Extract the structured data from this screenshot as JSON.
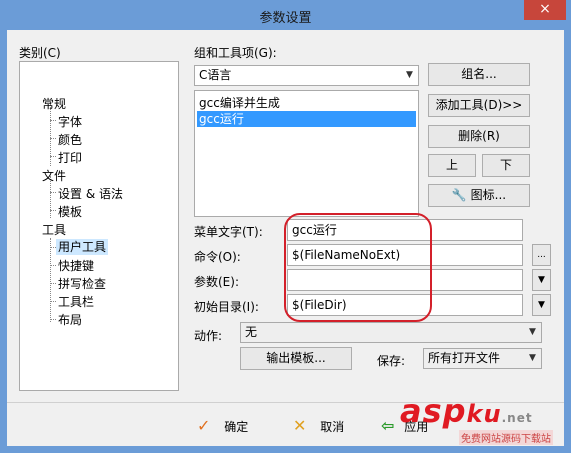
{
  "window": {
    "title": "参数设置",
    "close": "×"
  },
  "category": {
    "label": "类别(C)",
    "items": [
      "常规",
      "字体",
      "颜色",
      "打印",
      "文件",
      "设置 & 语法",
      "模板",
      "工具",
      "用户工具",
      "快捷键",
      "拼写检查",
      "工具栏",
      "布局"
    ]
  },
  "group": {
    "label": "组和工具项(G):",
    "selected": "C语言",
    "tools": [
      "gcc编译并生成",
      "gcc运行"
    ]
  },
  "buttons": {
    "group_name": "组名...",
    "add_tool": "添加工具(D)>>",
    "delete": "删除(R)",
    "up": "上",
    "down": "下",
    "icon": "图标...",
    "output_template": "输出模板...",
    "ok": "确定",
    "cancel": "取消",
    "apply": "应用",
    "browse": "..."
  },
  "fields": {
    "menu_text_label": "菜单文字(T):",
    "menu_text": "gcc运行",
    "command_label": "命令(O):",
    "command": "$(FileNameNoExt)",
    "args_label": "参数(E):",
    "args": "",
    "initdir_label": "初始目录(I):",
    "initdir": "$(FileDir)",
    "action_label": "动作:",
    "action": "无",
    "save_label": "保存:",
    "save": "所有打开文件"
  },
  "watermark": {
    "brand": "asp",
    "brand2": "ku",
    "tld": ".net",
    "sub": "免费网站源码下载站"
  },
  "colors": {
    "accent": "#6b9cd7",
    "selection": "#3399ff",
    "highlight": "#d3202a"
  }
}
